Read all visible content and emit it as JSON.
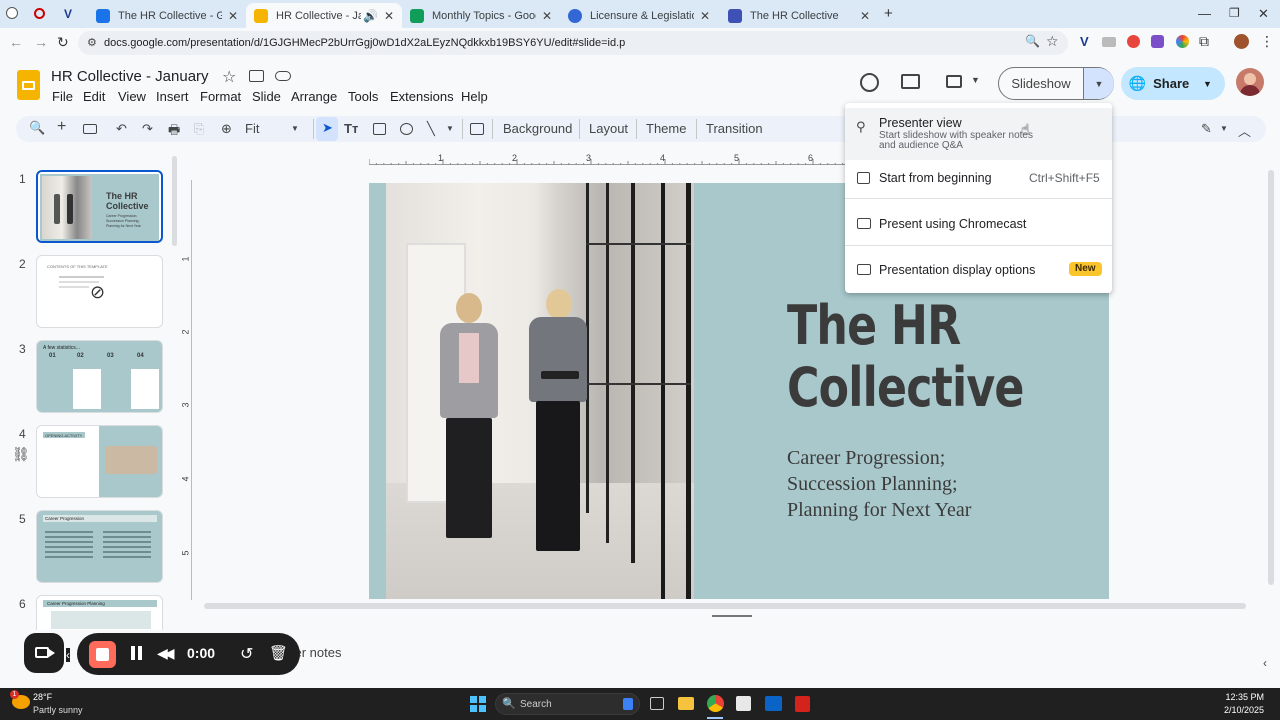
{
  "browser": {
    "tabs": [
      {
        "title": "The HR Collective - Google Drive",
        "color": "#1a73e8"
      },
      {
        "title": "HR Collective - January - Google Slides",
        "color": "#f4b400",
        "active": true
      },
      {
        "title": "Monthly Topics - Google Sheets",
        "color": "#0f9d58"
      },
      {
        "title": "Licensure & Legislation Newsletter",
        "color": "#3367d6"
      },
      {
        "title": "The HR Collective",
        "color": "#3f51b5"
      }
    ],
    "url": "docs.google.com/presentation/d/1GJGHMecP2bUrrGgj0wD1dX2aLEyzNQdkkxb19BSY6YU/edit#slide=id.p"
  },
  "doc": {
    "title": "HR Collective - January",
    "menu": [
      "File",
      "Edit",
      "View",
      "Insert",
      "Format",
      "Slide",
      "Arrange",
      "Tools",
      "Extensions",
      "Help"
    ],
    "slideshow_label": "Slideshow",
    "share_label": "Share"
  },
  "toolbar": {
    "zoom_label": "Fit",
    "background_label": "Background",
    "layout_label": "Layout",
    "theme_label": "Theme",
    "transition_label": "Transition"
  },
  "ruler": {
    "h_ticks": [
      "1",
      "2",
      "3",
      "4",
      "5",
      "6"
    ],
    "v_ticks": [
      "1",
      "2",
      "3",
      "4",
      "5"
    ]
  },
  "filmstrip": {
    "numbers": [
      "1",
      "2",
      "3",
      "4",
      "5",
      "6"
    ],
    "slide1": {
      "title": "The HR Collective",
      "sub": "Career Progression; Succession Planning; Planning for Next Year"
    },
    "slide2": {
      "title": "CONTENTS OF THIS TEMPLATE"
    },
    "slide3": {
      "title": "A few statistics...",
      "cols": [
        "01",
        "02",
        "03",
        "04"
      ]
    },
    "slide4": {
      "title": "OPENING ACTIVITY"
    },
    "slide5": {
      "title": "Career Progression"
    },
    "slide6": {
      "title": "Career Progression Planning"
    }
  },
  "slide": {
    "title_line1": "The HR",
    "title_line2": "Collective",
    "subtitle_line1": "Career Progression;",
    "subtitle_line2": "Succession Planning;",
    "subtitle_line3": "Planning for Next Year"
  },
  "dropdown": {
    "presenter_view": "Presenter view",
    "presenter_view_desc_1": "Start slideshow with speaker notes",
    "presenter_view_desc_2": "and audience Q&A",
    "start_beginning": "Start from beginning",
    "start_beginning_shortcut": "Ctrl+Shift+F5",
    "chromecast": "Present using Chromecast",
    "display_options": "Presentation display options",
    "new_badge": "New"
  },
  "notes": {
    "placeholder": "ker notes"
  },
  "recorder": {
    "time": "0:00"
  },
  "taskbar": {
    "weather_temp": "28°F",
    "weather_desc": "Partly sunny",
    "search_placeholder": "Search",
    "time": "12:35 PM",
    "date": "2/10/2025",
    "notif_count": "1"
  },
  "colors": {
    "accent": "#0b57d0",
    "slide_bg": "#a8c8cb",
    "share_bg": "#c2e7ff",
    "new_badge": "#f9c52a"
  }
}
